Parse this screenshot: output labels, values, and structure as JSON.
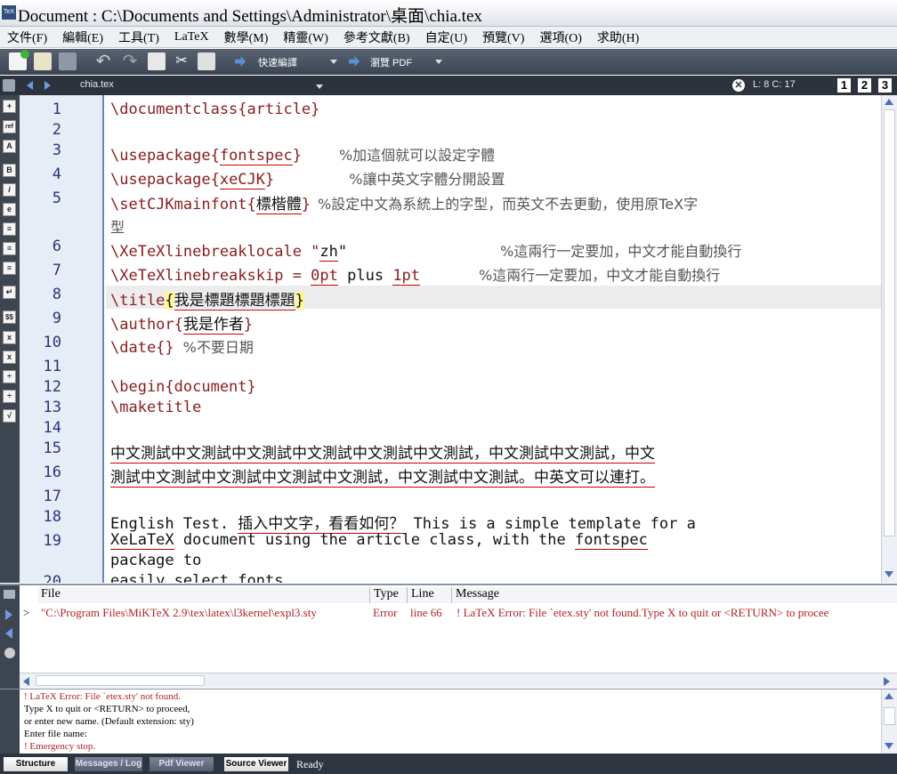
{
  "window": {
    "title": "Document : C:\\Documents and Settings\\Administrator\\桌面\\chia.tex",
    "app_icon": "TeX"
  },
  "menu": [
    "文件(F)",
    "編輯(E)",
    "工具(T)",
    "LaTeX",
    "數學(M)",
    "精靈(W)",
    "參考文獻(B)",
    "自定(U)",
    "預覽(V)",
    "選項(O)",
    "求助(H)"
  ],
  "toolbar": {
    "quick_build": "快速編譯",
    "view_pdf": "瀏覽 PDF"
  },
  "tabbar": {
    "file": "chia.tex",
    "cursor": "L: 8 C: 17",
    "views": [
      "1",
      "2",
      "3"
    ]
  },
  "leftbar_icons": [
    "ref",
    "B",
    "i",
    "e",
    "$$",
    "√"
  ],
  "editor": {
    "line_numbers": [
      "1",
      "2",
      "3",
      "4",
      "5",
      "",
      "6",
      "7",
      "8",
      "9",
      "10",
      "11",
      "12",
      "13",
      "14",
      "15",
      "16",
      "17",
      "18",
      "19",
      "",
      "20"
    ],
    "l1": "\\documentclass{article}",
    "l3a": "\\usepackage{",
    "l3b": "fontspec",
    "l3c": "}",
    "l3d": "%加這個就可以設定字體",
    "l4a": "\\usepackage{",
    "l4b": "xeCJK",
    "l4c": "}",
    "l4d": "%讓中英文字體分開設置",
    "l5a": "\\setCJKmainfont{",
    "l5b": "標楷體",
    "l5c": "}",
    "l5d": "%設定中文為系統上的字型，而英文不去更動，使用原TeX字",
    "l5e": "型",
    "l6a": "\\XeTeXlinebreaklocale \"",
    "l6b": "zh",
    "l6c": "\"",
    "l6d": "%這兩行一定要加，中文才能自動換行",
    "l7a": "\\XeTeXlinebreakskip = ",
    "l7b": "0pt",
    "l7c": " plus ",
    "l7d": "1pt",
    "l7e": "%這兩行一定要加，中文才能自動換行",
    "l8a": "\\title",
    "l8b": "{",
    "l8c": "我是標題標題標題",
    "l8d": "}",
    "l9a": "\\author{",
    "l9b": "我是作者",
    "l9c": "}",
    "l10a": "\\date{}",
    "l10b": "%不要日期",
    "l12": "\\begin{document}",
    "l13": "\\maketitle",
    "l15": "中文測試中文測試中文測試中文測試中文測試中文測試，中文測試中文測試，中文",
    "l16": "測試中文測試中文測試中文測試中文測試，中文測試中文測試。中英文可以連打。",
    "l18a": "English Test. ",
    "l18b": "插入中文字，看看如何？",
    "l18c": " This is a simple template for a",
    "l19a": "XeLaTeX",
    "l19b": " document using the article class, with the ",
    "l19c": "fontspec",
    "l19d": "package to",
    "l20": "easily select fonts"
  },
  "messages": {
    "headers": [
      "File",
      "Type",
      "Line",
      "Message"
    ],
    "rows": [
      {
        "marker": ">",
        "file": "\"C:\\Program Files\\MiKTeX 2.9\\tex\\latex\\l3kernel\\expl3.sty",
        "type": "Error",
        "line": "line 66",
        "message": "! LaTeX Error: File `etex.sty' not found.Type X to quit or <RETURN> to procee"
      }
    ]
  },
  "log": [
    "! LaTeX Error: File `etex.sty' not found.",
    "Type X to quit or <RETURN> to proceed,",
    "or enter new name. (Default extension: sty)",
    "Enter file name:",
    "! Emergency stop."
  ],
  "status": {
    "tabs": [
      "Structure",
      "Messages / Log",
      "Pdf Viewer",
      "Source Viewer"
    ],
    "text": "Ready"
  },
  "colors": {
    "comment": "#555555",
    "command": "#8a1c1c",
    "error": "#b22222",
    "current_line": "#ececec"
  }
}
